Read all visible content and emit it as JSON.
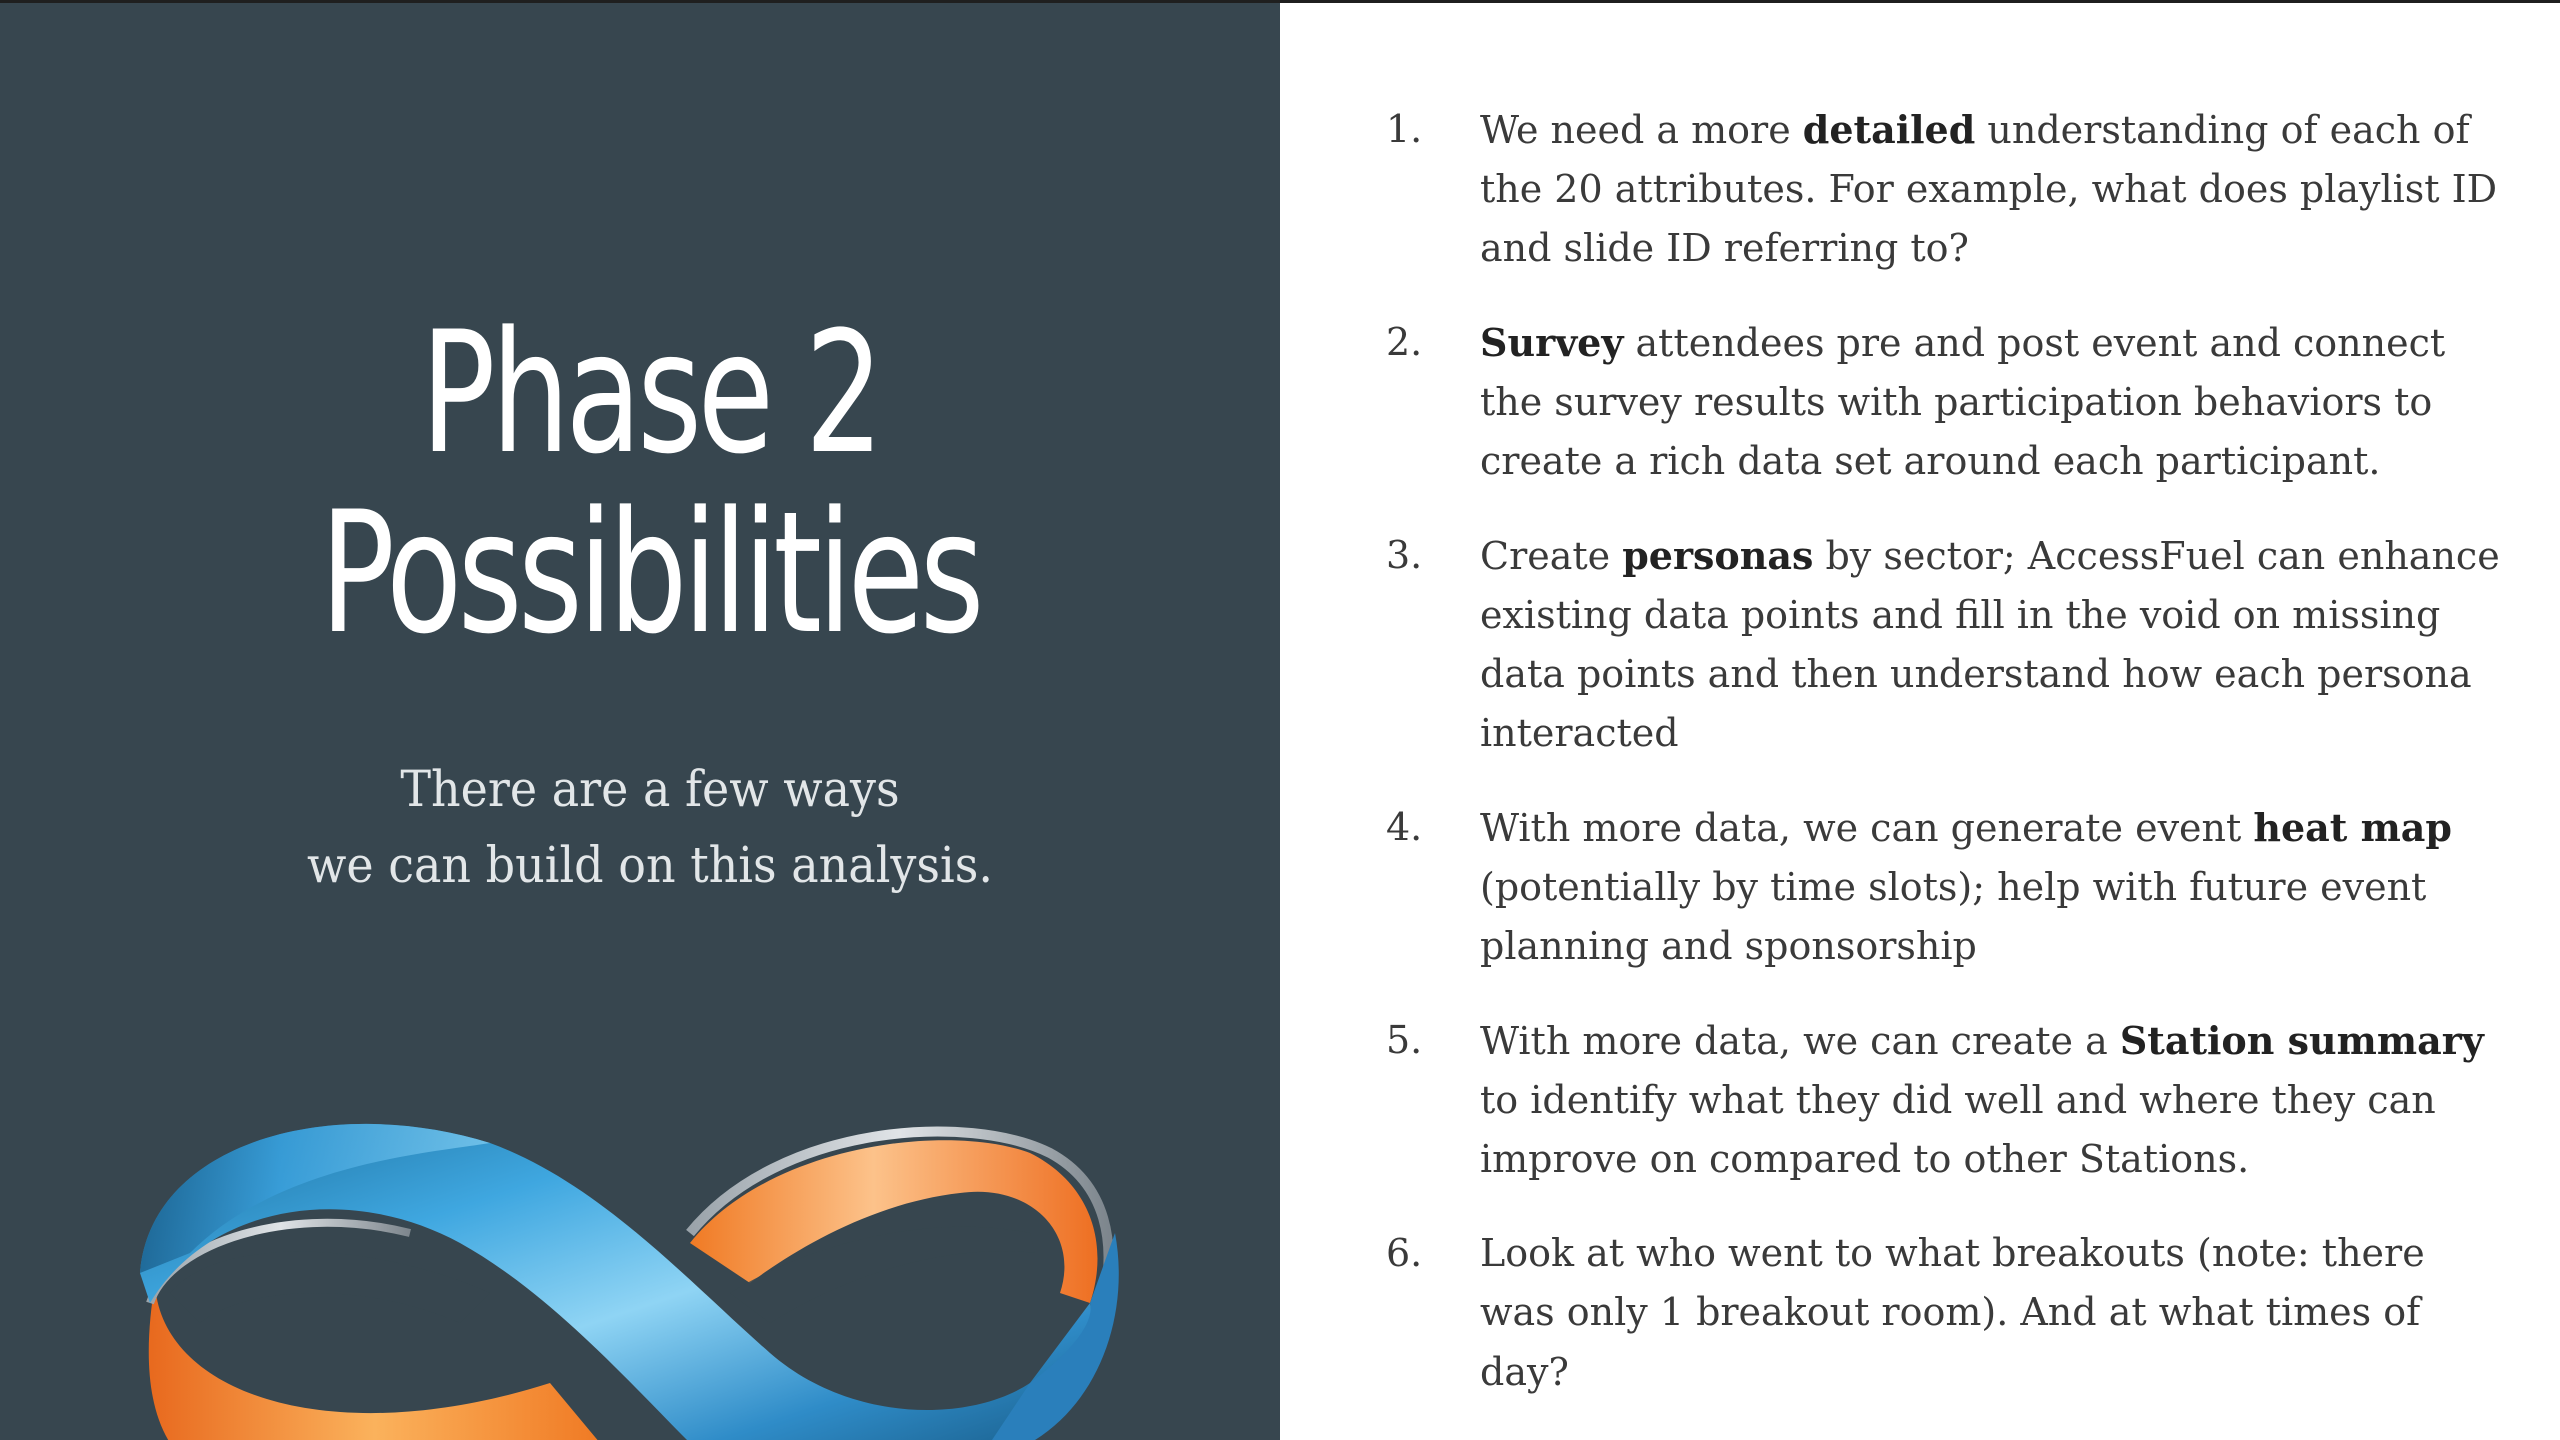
{
  "slide": {
    "title_line1": "Phase 2",
    "title_line2": "Possibilities",
    "subtitle_line1": "There are a few ways",
    "subtitle_line2": "we can build on this analysis.",
    "logo": "infinity-ribbon-icon",
    "colors": {
      "panel": "#37464f",
      "ribbon_blue": "#3a9fd8",
      "ribbon_orange": "#f0822e",
      "text": "#3a3a3a"
    }
  },
  "items": [
    {
      "num": "1.",
      "pre": "We need a more ",
      "bold": "detailed",
      "post": " understanding of each of the 20 attributes. For example, what does playlist ID and slide ID referring to?"
    },
    {
      "num": "2.",
      "pre": "",
      "bold": "Survey",
      "post": " attendees pre and post event and connect the survey results with participation behaviors to create a rich data set around each participant."
    },
    {
      "num": "3.",
      "pre": "Create ",
      "bold": "personas",
      "post": " by sector; AccessFuel can enhance existing data points and fill in the void on missing data points and then understand how each persona interacted"
    },
    {
      "num": "4.",
      "pre": "With more data, we can generate event ",
      "bold": "heat map",
      "post": " (potentially by time slots); help with future event planning and sponsorship"
    },
    {
      "num": "5.",
      "pre": "With more data, we can create a ",
      "bold": "Station summary",
      "post": " to identify what they did well and where they can improve on compared to other Stations."
    },
    {
      "num": "6.",
      "pre": " Look at who went to what breakouts (note: there was only 1 breakout room). And at what times of day?",
      "bold": "",
      "post": ""
    }
  ]
}
